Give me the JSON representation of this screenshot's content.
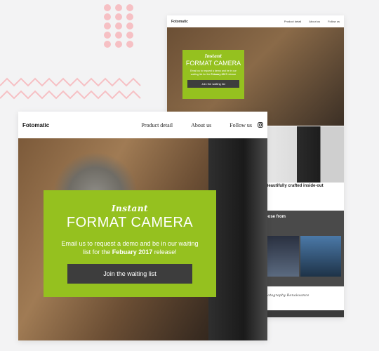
{
  "front": {
    "brand": "Fotomatic",
    "nav": {
      "product": "Product detail",
      "about": "About us",
      "follow": "Follow us"
    },
    "hero": {
      "kicker": "Instant",
      "title": "FORMAT CAMERA",
      "text_before": "Email us to request a demo and be in our waiting list for the",
      "text_bold": "Febuary 2017",
      "text_after": "release!",
      "button": "Join the waiting list"
    }
  },
  "back": {
    "brand": "Fotomatic",
    "nav": {
      "product": "Product detail",
      "about": "About us",
      "follow": "Follow us"
    },
    "hero": {
      "kicker": "Instant",
      "title": "FORMAT CAMERA",
      "text_before": "Email us to request a demo and be in our waiting list for the",
      "text_bold": "Febuary 2017",
      "text_after": "release",
      "button": "Join the waiting list"
    },
    "section2": {
      "heading": "Beautifully crafted inside-out"
    },
    "section3": {
      "heading": "oose from"
    },
    "section4": {
      "quote": "hotography Renaissance"
    }
  },
  "colors": {
    "accent": "#95c11f",
    "button": "#3d3d3d",
    "dots": "#f6c0c4"
  }
}
